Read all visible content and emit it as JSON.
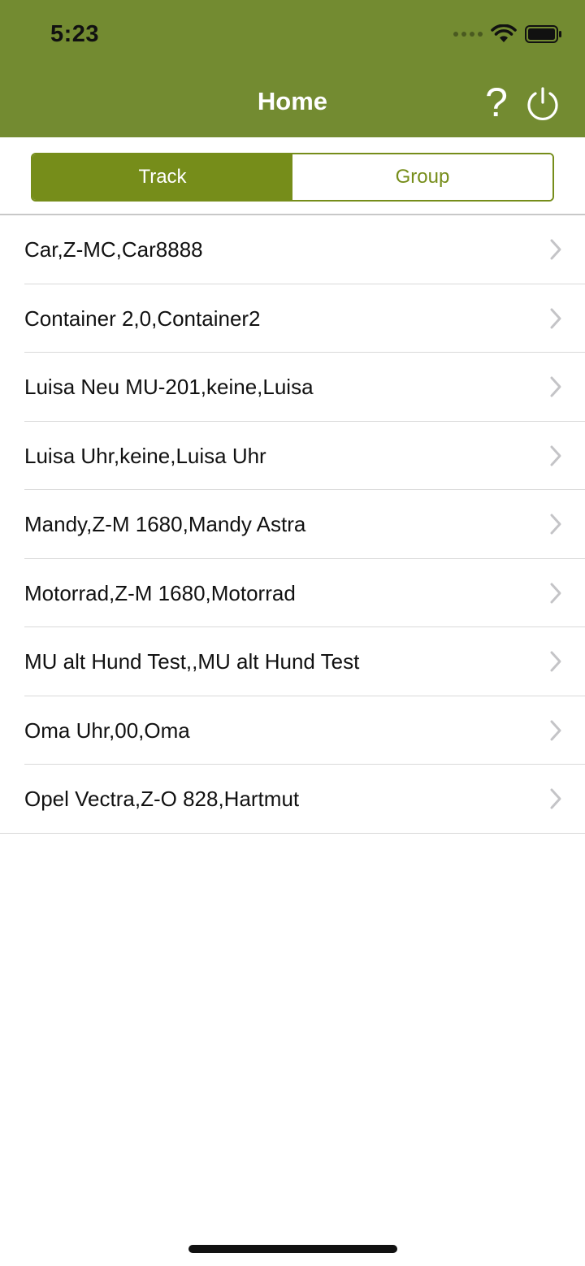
{
  "status_bar": {
    "time": "5:23"
  },
  "nav": {
    "title": "Home",
    "help_label": "?"
  },
  "segments": {
    "track": "Track",
    "group": "Group",
    "selected": "Track"
  },
  "list": {
    "items": [
      {
        "label": "Car,Z-MC,Car8888"
      },
      {
        "label": "Container 2,0,Container2"
      },
      {
        "label": "Luisa Neu MU-201,keine,Luisa"
      },
      {
        "label": "Luisa Uhr,keine,Luisa Uhr"
      },
      {
        "label": "Mandy,Z-M 1680,Mandy Astra"
      },
      {
        "label": "Motorrad,Z-M 1680,Motorrad"
      },
      {
        "label": "MU alt Hund Test,,MU alt Hund Test"
      },
      {
        "label": "Oma Uhr,00,Oma"
      },
      {
        "label": "Opel Vectra,Z-O 828,Hartmut"
      }
    ]
  },
  "icons": {
    "help": "question-mark-icon",
    "power": "power-icon",
    "chevron": "chevron-right-icon",
    "wifi": "wifi-icon",
    "battery": "battery-icon",
    "signal": "cellular-signal-icon"
  },
  "colors": {
    "header": "#738b31",
    "accent": "#768d1a",
    "text": "#111111",
    "chevron": "#c4c4c7"
  }
}
